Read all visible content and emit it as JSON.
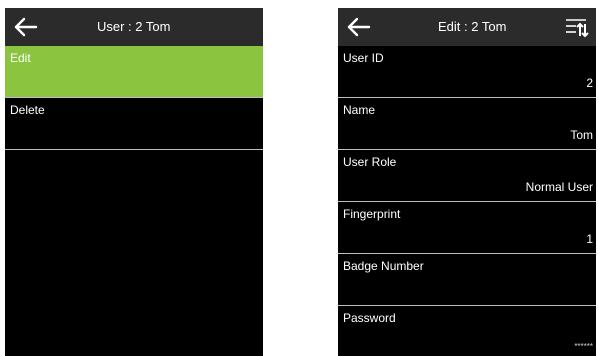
{
  "left_screen": {
    "title": "User : 2 Tom",
    "menu": [
      {
        "label": "Edit"
      },
      {
        "label": "Delete"
      }
    ]
  },
  "right_screen": {
    "title": "Edit : 2 Tom",
    "fields": [
      {
        "label": "User ID",
        "value": "2"
      },
      {
        "label": "Name",
        "value": "Tom"
      },
      {
        "label": "User Role",
        "value": "Normal User"
      },
      {
        "label": "Fingerprint",
        "value": "1"
      },
      {
        "label": "Badge Number",
        "value": ""
      },
      {
        "label": "Password",
        "value": "******"
      }
    ]
  },
  "icons": {
    "back": "back-arrow-icon",
    "sort": "sort-icon"
  },
  "colors": {
    "header_bg": "#2b2b2b",
    "screen_bg": "#000000",
    "highlight": "#8bc53f",
    "divider": "#bdbdbd"
  }
}
